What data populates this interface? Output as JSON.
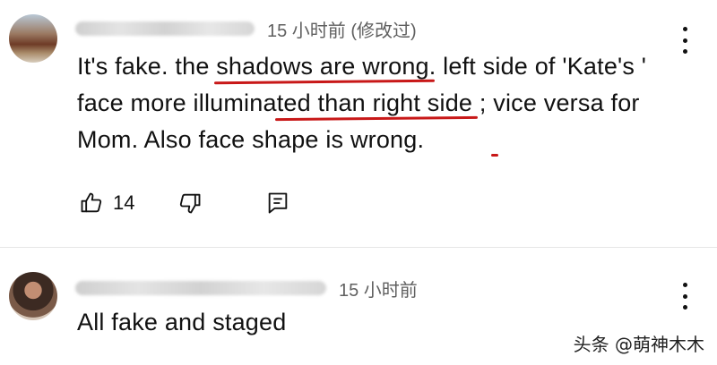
{
  "comments": [
    {
      "timestamp": "15 小时前 (修改过)",
      "text_parts": [
        "It's fake. the ",
        "shadows are wrong",
        ". left side of 'Kate's ' face more illumina",
        "ted than right side",
        " ; ",
        "vice versa for Mom",
        ". Also face shape is wrong."
      ],
      "like_count": "14"
    },
    {
      "timestamp": "15 小时前",
      "text": "All fake and staged"
    }
  ],
  "watermark": "头条 @萌神木木",
  "icons": {
    "like": "thumb-up-icon",
    "dislike": "thumb-down-icon",
    "reply": "reply-icon",
    "more": "more-vert-icon"
  },
  "colors": {
    "underline": "#c81818",
    "meta_text": "#606060"
  }
}
